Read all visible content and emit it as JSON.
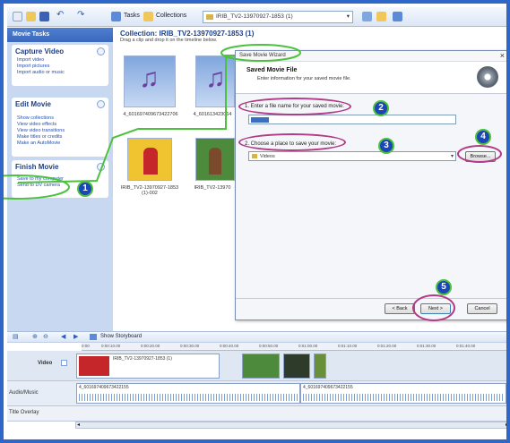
{
  "toolbar": {
    "tasks_label": "Tasks",
    "collections_label": "Collections",
    "collection_combo": "IRIB_TV2-13970927-1853 (1)"
  },
  "task_pane": {
    "header": "Movie Tasks",
    "capture": {
      "title": "Capture Video",
      "items": [
        "Import video",
        "Import pictures",
        "Import audio or music"
      ]
    },
    "edit": {
      "title": "Edit Movie",
      "items": [
        "Show collections",
        "View video effects",
        "View video transitions",
        "Make titles or credits",
        "Make an AutoMovie"
      ]
    },
    "finish": {
      "title": "Finish Movie",
      "items": [
        "Save to my computer",
        "Send to DV camera"
      ]
    }
  },
  "collection": {
    "title": "Collection: IRIB_TV2-13970927-1853 (1)",
    "hint": "Drag a clip and drop it on the timeline below.",
    "clips": [
      {
        "label": "4_601697409673422706"
      },
      {
        "label": "4_601613423064"
      },
      {
        "label": "IRIB_TV2-13970927-1853 (1)-002"
      },
      {
        "label": "IRIB_TV2-13970"
      }
    ]
  },
  "dialog": {
    "window_title": "Save Movie Wizard",
    "header_title": "Saved Movie File",
    "header_subtitle": "Enter information for your saved movie file.",
    "field1_label": "1. Enter a file name for your saved movie:",
    "field1_value": "",
    "field2_label": "2. Choose a place to save your movie:",
    "field2_value": "Videos",
    "browse_label": "Browse...",
    "back_label": "< Back",
    "next_label": "Next >",
    "cancel_label": "Cancel"
  },
  "timeline": {
    "show_storyboard": "Show Storyboard",
    "ruler_labels": [
      "0:00",
      "0:00:10.00",
      "0:00:20.00",
      "0:00:30.00",
      "0:00:40.00",
      "0:00:50.00",
      "0:01:00.00",
      "0:01:10.00",
      "0:01:20.00",
      "0:01:30.00",
      "0:01:40.00"
    ],
    "video_label": "Video",
    "audio_label": "Audio/Music",
    "title_label": "Title Overlay",
    "video_clip_name": "IRIB_TV2-13970927-1853 (1)",
    "audio_clip_1": "4_601697409673422155",
    "audio_clip_2": "4_601697409673422155"
  },
  "callouts": [
    "1",
    "2",
    "3",
    "4",
    "5"
  ],
  "colors": {
    "frame": "#2f67c8",
    "callout_fill": "#1b46b8",
    "callout_border": "#4cc13d",
    "oval": "#b23a86"
  }
}
